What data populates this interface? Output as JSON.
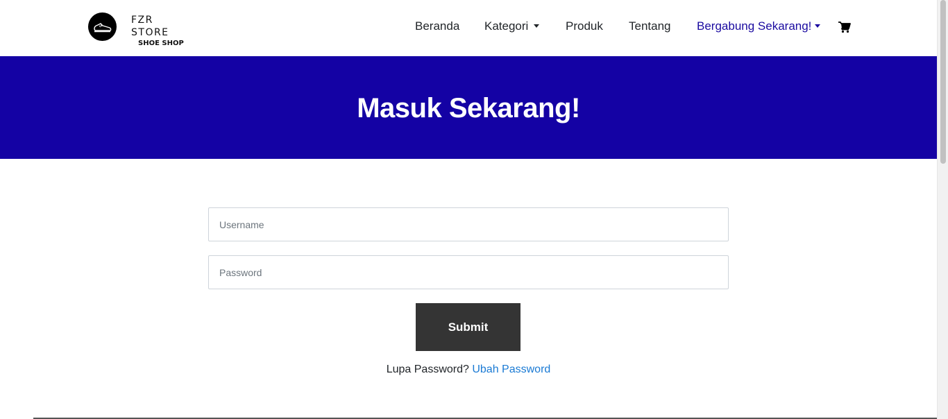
{
  "brand": {
    "name": "FZR STORE",
    "subtitle": "SHOE SHOP",
    "logo_icon": "sneaker-icon"
  },
  "nav": {
    "items": [
      {
        "label": "Beranda"
      },
      {
        "label": "Kategori",
        "dropdown": true
      },
      {
        "label": "Produk"
      },
      {
        "label": "Tentang"
      },
      {
        "label": "Bergabung Sekarang!",
        "dropdown": true,
        "active": true
      }
    ],
    "cart_icon": "cart-icon"
  },
  "hero": {
    "title": "Masuk Sekarang!"
  },
  "form": {
    "username_placeholder": "Username",
    "username_value": "",
    "password_placeholder": "Password",
    "password_value": "",
    "submit_label": "Submit"
  },
  "forgot": {
    "text": "Lupa Password?",
    "link_label": "Ubah Password"
  },
  "colors": {
    "hero_bg": "#1402a4",
    "active_nav": "#1a0aa0",
    "link": "#1a7ad4",
    "button_bg": "#343434"
  }
}
